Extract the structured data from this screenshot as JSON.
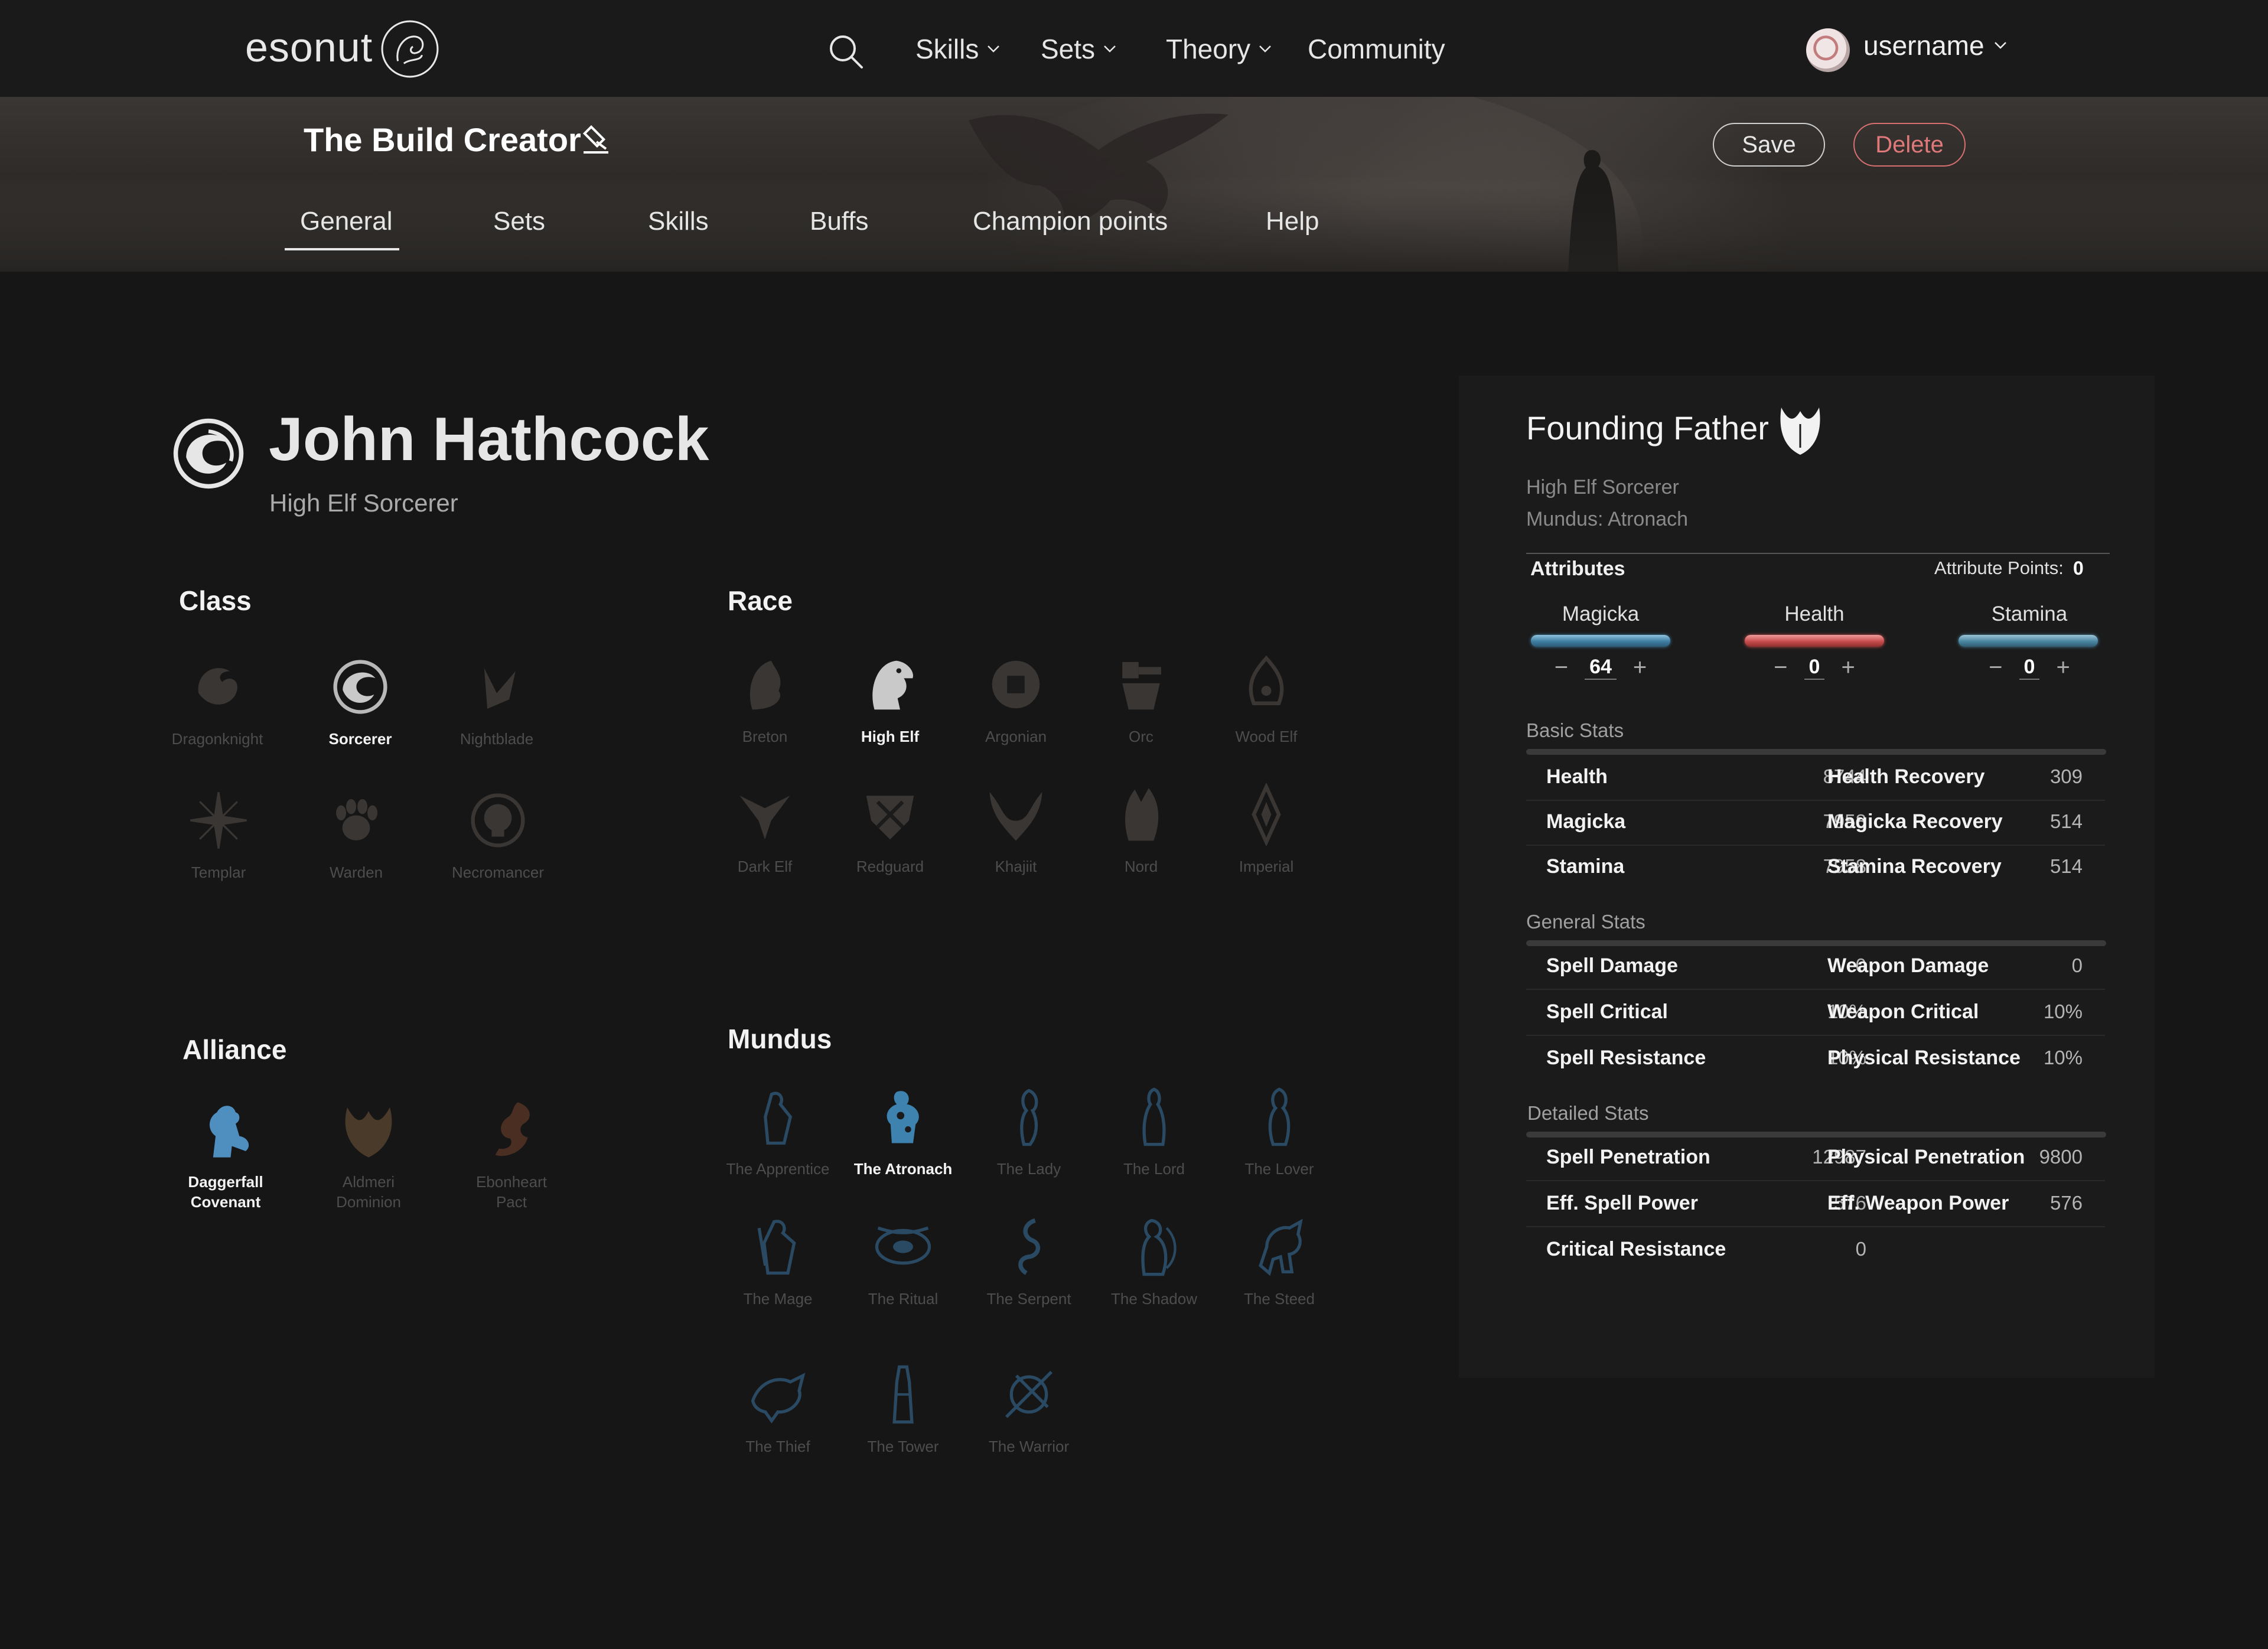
{
  "nav": {
    "brand": "esonut",
    "items": [
      "Skills",
      "Sets",
      "Theory",
      "Community"
    ],
    "username": "username"
  },
  "header": {
    "title": "The Build Creator",
    "save_label": "Save",
    "delete_label": "Delete",
    "tabs": [
      "General",
      "Sets",
      "Skills",
      "Buffs",
      "Champion points",
      "Help"
    ],
    "active_tab": "General"
  },
  "character": {
    "name": "John Hathcock",
    "subtitle": "High Elf Sorcerer"
  },
  "class": {
    "title": "Class",
    "options": [
      "Dragonknight",
      "Sorcerer",
      "Nightblade",
      "Templar",
      "Warden",
      "Necromancer"
    ],
    "selected": "Sorcerer"
  },
  "race": {
    "title": "Race",
    "options": [
      "Breton",
      "High Elf",
      "Argonian",
      "Orc",
      "Wood Elf",
      "Dark Elf",
      "Redguard",
      "Khajiit",
      "Nord",
      "Imperial"
    ],
    "selected": "High Elf"
  },
  "alliance": {
    "title": "Alliance",
    "options": [
      [
        "Daggerfall",
        "Covenant"
      ],
      [
        "Aldmeri",
        "Dominion"
      ],
      [
        "Ebonheart",
        "Pact"
      ]
    ],
    "selected": "Daggerfall Covenant",
    "colors": {
      "Daggerfall Covenant": "#4f8fc0",
      "Aldmeri Dominion": "#4a3a2a",
      "Ebonheart Pact": "#4a2e22"
    }
  },
  "mundus": {
    "title": "Mundus",
    "options": [
      "The Apprentice",
      "The Atronach",
      "The Lady",
      "The Lord",
      "The Lover",
      "The Mage",
      "The Ritual",
      "The Serpent",
      "The Shadow",
      "The Steed",
      "The Thief",
      "The Tower",
      "The Warrior"
    ],
    "selected": "The Atronach",
    "color": "#2a4a64",
    "selected_color": "#3e82b0"
  },
  "panel": {
    "title": "Founding Father",
    "race_class": "High Elf Sorcerer",
    "mundus": "Mundus: Atronach",
    "attributes": {
      "title": "Attributes",
      "points_label": "Attribute Points:",
      "points": "0",
      "items": [
        {
          "name": "Magicka",
          "value": "64",
          "color": "#3e7ea3"
        },
        {
          "name": "Health",
          "value": "0",
          "color": "#c84d4d"
        },
        {
          "name": "Stamina",
          "value": "0",
          "color": "#4a86a2"
        }
      ]
    },
    "basic_stats": {
      "title": "Basic Stats",
      "rows": [
        [
          "Health",
          "8744",
          "Health Recovery",
          "309"
        ],
        [
          "Magicka",
          "7958",
          "Magicka Recovery",
          "514"
        ],
        [
          "Stamina",
          "7958",
          "Stamina Recovery",
          "514"
        ]
      ]
    },
    "general_stats": {
      "title": "General Stats",
      "rows": [
        [
          "Spell Damage",
          "0",
          "Weapon Damage",
          "0"
        ],
        [
          "Spell Critical",
          "10%",
          "Weapon Critical",
          "10%"
        ],
        [
          "Spell Resistance",
          "10%",
          "Physical Resistance",
          "10%"
        ]
      ]
    },
    "detailed_stats": {
      "title": "Detailed Stats",
      "rows": [
        [
          "Spell Penetration",
          "12987",
          "Physical Penetration",
          "9800"
        ],
        [
          "Eff. Spell Power",
          "576",
          "Eff. Weapon Power",
          "576"
        ],
        [
          "Critical Resistance",
          "0",
          "",
          ""
        ]
      ]
    }
  }
}
